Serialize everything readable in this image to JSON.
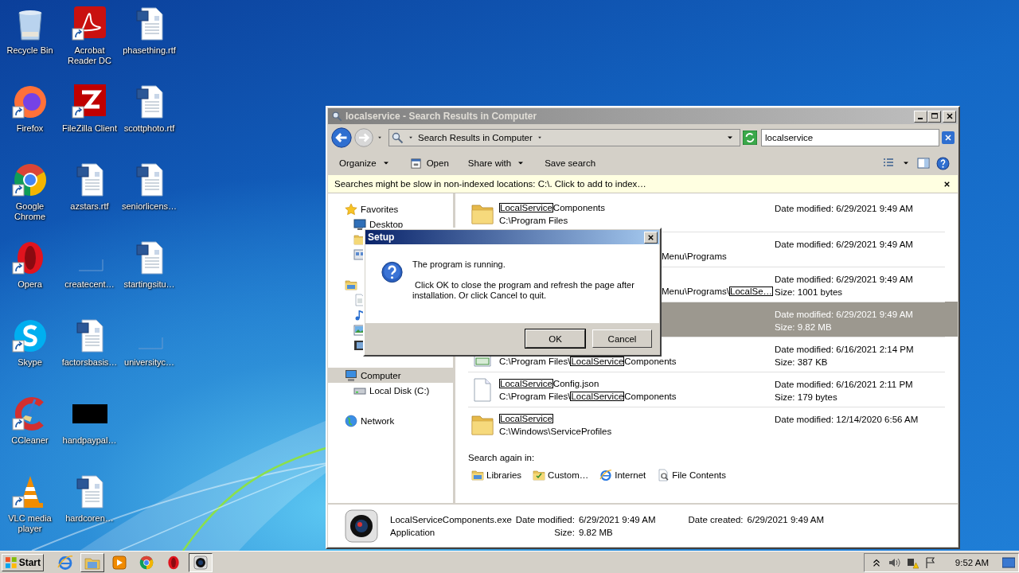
{
  "desktop": {
    "icons": [
      {
        "label": "Recycle Bin",
        "kind": "recycle",
        "shortcut": false
      },
      {
        "label": "Firefox",
        "kind": "firefox",
        "shortcut": true
      },
      {
        "label": "Google Chrome",
        "kind": "chrome",
        "shortcut": true
      },
      {
        "label": "Opera",
        "kind": "opera",
        "shortcut": true
      },
      {
        "label": "Skype",
        "kind": "skype",
        "shortcut": true
      },
      {
        "label": "CCleaner",
        "kind": "ccleaner",
        "shortcut": true
      },
      {
        "label": "VLC media player",
        "kind": "vlc",
        "shortcut": true
      },
      {
        "label": "Acrobat Reader DC",
        "kind": "acrobat",
        "shortcut": true
      },
      {
        "label": "FileZilla Client",
        "kind": "filezilla",
        "shortcut": true
      },
      {
        "label": "azstars.rtf",
        "kind": "word",
        "shortcut": false
      },
      {
        "label": "createcent…",
        "kind": "blank",
        "shortcut": false
      },
      {
        "label": "factorsbasis…",
        "kind": "word",
        "shortcut": false
      },
      {
        "label": "handpaypal…",
        "kind": "black",
        "shortcut": false
      },
      {
        "label": "hardcoren…",
        "kind": "word",
        "shortcut": false
      },
      {
        "label": "phasething.rtf",
        "kind": "word",
        "shortcut": false
      },
      {
        "label": "scottphoto.rtf",
        "kind": "word",
        "shortcut": false
      },
      {
        "label": "seniorlicens…",
        "kind": "word",
        "shortcut": false
      },
      {
        "label": "startingsitu…",
        "kind": "word",
        "shortcut": false
      },
      {
        "label": "universityc…",
        "kind": "blank",
        "shortcut": false
      }
    ]
  },
  "explorer": {
    "title": "localservice - Search Results in Computer",
    "address": {
      "path": "Search Results in Computer"
    },
    "search": {
      "value": "localservice"
    },
    "toolbar": [
      {
        "label": "Organize",
        "kind": "menu"
      },
      {
        "label": "Open",
        "kind": "open"
      },
      {
        "label": "Share with",
        "kind": "menu"
      },
      {
        "label": "Save search",
        "kind": "plain"
      }
    ],
    "info_bar": "Searches might be slow in non-indexed locations: C:\\. Click to add to index…",
    "nav": [
      {
        "label": "Favorites",
        "kind": "star",
        "selected": false,
        "children": [
          {
            "label": "Desktop",
            "kind": "desktop",
            "selected": false
          },
          {
            "kind": "folder",
            "selected": false
          },
          {
            "kind": "places",
            "selected": false
          }
        ]
      },
      {
        "kind": "library",
        "selected": false,
        "children": [
          {
            "kind": "doc",
            "selected": false
          },
          {
            "kind": "music",
            "selected": false
          },
          {
            "kind": "pictures",
            "selected": false
          },
          {
            "kind": "video",
            "selected": false
          }
        ]
      },
      {
        "label": "Computer",
        "kind": "computer",
        "selected": true,
        "children": [
          {
            "label": "Local Disk (C:)",
            "kind": "disk",
            "selected": false
          }
        ]
      },
      {
        "label": "Network",
        "kind": "network",
        "selected": false
      }
    ],
    "results": [
      {
        "kind": "bigfolder",
        "name": [
          {
            "text": "LocalService",
            "match": true
          },
          {
            "text": "Components",
            "match": false
          }
        ],
        "path": [
          {
            "text": "C:\\Program Files",
            "match": false
          }
        ],
        "path_covered": false,
        "date": "Date modified: 6/29/2021 9:49 AM",
        "selected": false
      },
      {
        "path": [
          {
            "text": "Menu\\Programs",
            "match": false
          }
        ],
        "path_covered": true,
        "date": "Date modified: 6/29/2021 9:49 AM",
        "selected": false
      },
      {
        "path": [
          {
            "text": "Menu\\Programs\\",
            "match": false
          },
          {
            "text": "LocalSe…",
            "match": true
          }
        ],
        "path_covered": true,
        "date": "Date modified: 6/29/2021 9:49 AM",
        "size": "Size: 1001 bytes",
        "selected": false
      },
      {
        "path_covered": false,
        "date": "Date modified: 6/29/2021 9:49 AM",
        "size": "Size: 9.82 MB",
        "selected": true
      },
      {
        "kind": "sheet",
        "path": [
          {
            "text": "C:\\Program Files\\",
            "match": false
          },
          {
            "text": "LocalService",
            "match": true
          },
          {
            "text": "Components",
            "match": false
          }
        ],
        "path_covered": false,
        "date": "Date modified: 6/16/2021 2:14 PM",
        "size": "Size: 387 KB",
        "selected": false
      },
      {
        "kind": "file",
        "name": [
          {
            "text": "LocalService",
            "match": true
          },
          {
            "text": "Config.json",
            "match": false
          }
        ],
        "path": [
          {
            "text": "C:\\Program Files\\",
            "match": false
          },
          {
            "text": "LocalService",
            "match": true
          },
          {
            "text": "Components",
            "match": false
          }
        ],
        "path_covered": false,
        "date": "Date modified: 6/16/2021 2:11 PM",
        "size": "Size: 179 bytes",
        "selected": false
      },
      {
        "kind": "bigfolder",
        "name": [
          {
            "text": "LocalService",
            "match": true
          }
        ],
        "path": [
          {
            "text": "C:\\Windows\\ServiceProfiles",
            "match": false
          }
        ],
        "path_covered": false,
        "date": "Date modified: 12/14/2020 6:56 AM",
        "selected": false
      }
    ],
    "search_again": {
      "label": "Search again in:",
      "links": [
        {
          "label": "Libraries",
          "kind": "library"
        },
        {
          "label": "Custom…",
          "kind": "custom"
        },
        {
          "label": "Internet",
          "kind": "ie"
        },
        {
          "label": "File Contents",
          "kind": "contents"
        }
      ]
    },
    "details": {
      "name": "LocalServiceComponents.exe",
      "type": "Application",
      "fields": [
        {
          "label": "Date modified:",
          "value": "6/29/2021 9:49 AM"
        },
        {
          "label": "Size:",
          "value": "9.82 MB"
        },
        {
          "label": "Date created:",
          "value": "6/29/2021 9:49 AM"
        }
      ]
    }
  },
  "dialog": {
    "title": "Setup",
    "message": [
      "The program is running.",
      " Click OK to close the program and refresh the page after installation. Or click Cancel to quit."
    ],
    "buttons": [
      {
        "label": "OK",
        "default": true
      },
      {
        "label": "Cancel",
        "default": false
      }
    ]
  },
  "taskbar": {
    "start": "Start",
    "items": [
      {
        "kind": "ie",
        "open": false,
        "selected": false
      },
      {
        "kind": "explorer",
        "open": true,
        "selected": false
      },
      {
        "kind": "media",
        "open": false,
        "selected": false
      },
      {
        "kind": "chrome",
        "open": false,
        "selected": false
      },
      {
        "kind": "opera",
        "open": false,
        "selected": false
      },
      {
        "kind": "app",
        "open": true,
        "selected": true
      }
    ],
    "time": "9:52 AM"
  }
}
